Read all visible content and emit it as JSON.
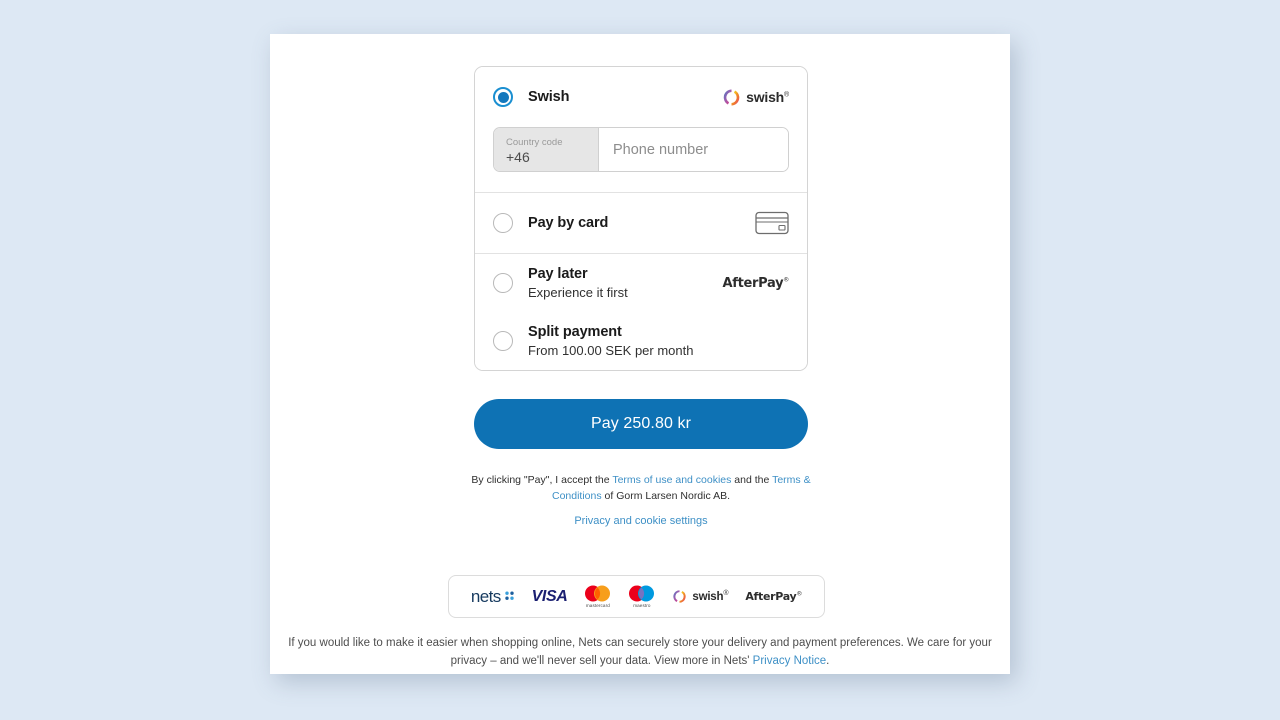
{
  "theme": {
    "page_background": "#dde8f4",
    "sheet_background": "#ffffff",
    "accent_blue": "#0e72b4",
    "link_blue": "#3e90c6",
    "radio_selected": "#1478bd"
  },
  "payment_methods": [
    {
      "id": "swish",
      "title": "Swish",
      "subtitle": "",
      "selected": true,
      "logo": "swish-logo",
      "fields": {
        "country_code_label": "Country code",
        "country_code_value": "+46",
        "phone_placeholder": "Phone number",
        "phone_value": ""
      }
    },
    {
      "id": "pay-by-card",
      "title": "Pay by card",
      "subtitle": "",
      "selected": false,
      "logo": "credit-card-icon"
    },
    {
      "id": "pay-later",
      "title": "Pay later",
      "subtitle": "Experience it first",
      "selected": false,
      "logo": "afterpay-logo"
    },
    {
      "id": "split-payment",
      "title": "Split payment",
      "subtitle": "From 100.00 SEK per month",
      "selected": false,
      "logo": ""
    }
  ],
  "pay_button": {
    "label": "Pay 250.80 kr",
    "amount": "250.80",
    "currency": "kr"
  },
  "legal": {
    "prefix": "By clicking \"Pay\", I accept the ",
    "terms_of_use_link": "Terms of use and cookies",
    "middle": " and the ",
    "terms_conditions_link": "Terms & Conditions",
    "suffix": " of Gorm Larsen Nordic AB.",
    "privacy_settings_link": "Privacy and cookie settings"
  },
  "brand_bar": {
    "nets": "nets",
    "visa": "VISA",
    "mastercard_caption": "mastercard",
    "maestro_caption": "maestro",
    "swish": "swish",
    "afterpay": "AfterPay"
  },
  "footnote": {
    "line1": "If you would like to make it easier when shopping online, Nets can securely store your delivery and payment preferences. We care",
    "line2_prefix": "for your privacy – and we'll never sell your data. View more in Nets' ",
    "privacy_notice_link": "Privacy Notice",
    "line2_suffix": "."
  }
}
